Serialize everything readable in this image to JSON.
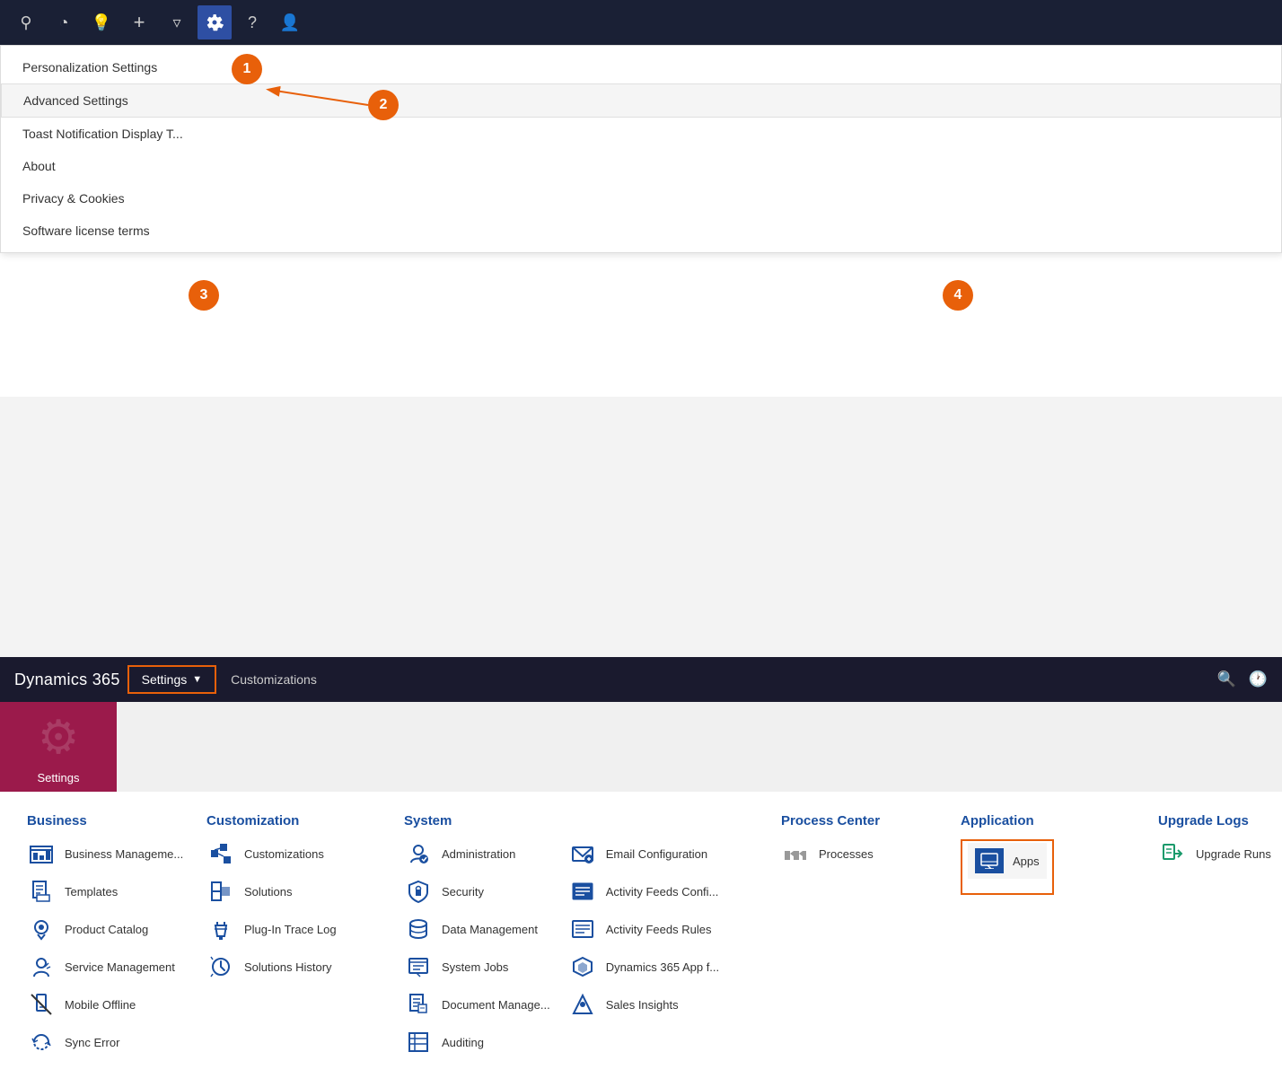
{
  "topNav": {
    "icons": [
      "search",
      "activity",
      "lightbulb",
      "plus",
      "filter",
      "settings",
      "help",
      "user"
    ]
  },
  "dropdown": {
    "items": [
      {
        "label": "Personalization Settings",
        "highlighted": false
      },
      {
        "label": "Advanced Settings",
        "highlighted": true
      },
      {
        "label": "Toast Notification Display T...",
        "highlighted": false
      },
      {
        "label": "About",
        "highlighted": false
      },
      {
        "label": "Privacy & Cookies",
        "highlighted": false
      },
      {
        "label": "Software license terms",
        "highlighted": false
      }
    ]
  },
  "annotations": [
    {
      "number": "1"
    },
    {
      "number": "2"
    },
    {
      "number": "3"
    },
    {
      "number": "4"
    }
  ],
  "mainNav": {
    "brand": "Dynamics 365",
    "settingsBtn": "Settings",
    "customizationsLink": "Customizations"
  },
  "settingsTile": {
    "label": "Settings"
  },
  "sections": {
    "business": {
      "header": "Business",
      "items": [
        {
          "label": "Business Manageme..."
        },
        {
          "label": "Templates"
        },
        {
          "label": "Product Catalog"
        },
        {
          "label": "Service Management"
        },
        {
          "label": "Mobile Offline"
        },
        {
          "label": "Sync Error"
        }
      ]
    },
    "customization": {
      "header": "Customization",
      "items": [
        {
          "label": "Customizations"
        },
        {
          "label": "Solutions"
        },
        {
          "label": "Plug-In Trace Log"
        },
        {
          "label": "Solutions History"
        }
      ]
    },
    "system": {
      "header": "System",
      "col1": [
        {
          "label": "Administration"
        },
        {
          "label": "Security"
        },
        {
          "label": "Data Management"
        },
        {
          "label": "System Jobs"
        },
        {
          "label": "Document Manage..."
        },
        {
          "label": "Auditing"
        }
      ],
      "col2": [
        {
          "label": "Email Configuration"
        },
        {
          "label": "Activity Feeds Confi..."
        },
        {
          "label": "Activity Feeds Rules"
        },
        {
          "label": "Dynamics 365 App f..."
        },
        {
          "label": "Sales Insights"
        }
      ]
    },
    "processCenter": {
      "header": "Process Center",
      "items": [
        {
          "label": "Processes"
        }
      ]
    },
    "application": {
      "header": "Application",
      "items": [
        {
          "label": "Apps"
        }
      ]
    },
    "upgradeLogs": {
      "header": "Upgrade Logs",
      "items": [
        {
          "label": "Upgrade Runs"
        }
      ]
    }
  }
}
